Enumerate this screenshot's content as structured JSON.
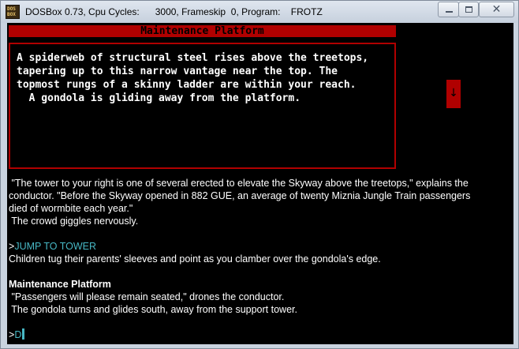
{
  "window": {
    "icon_line1": "DOS",
    "icon_line2": "BOX",
    "title": "DOSBox 0.73, Cpu Cycles:      3000, Frameskip  0, Program:    FROTZ"
  },
  "status": {
    "location": "Maintenance Platform"
  },
  "description": [
    "A spiderweb of structural steel rises above the treetops,",
    "tapering up to this narrow vantage near the top. The",
    "topmost rungs of a skinny ladder are within your reach.",
    "  A gondola is gliding away from the platform."
  ],
  "transcript": {
    "paragraph_lines": [
      " \"The tower to your right is one of several erected to elevate the Skyway above the treetops,\" explains the",
      "conductor. \"Before the Skyway opened in 882 GUE, an average of twenty Miznia Jungle Train passengers",
      "died of wormbite each year.\"",
      " The crowd giggles nervously."
    ],
    "prompt_symbol": ">",
    "command": "JUMP TO TOWER",
    "response": "Children tug their parents' sleeves and point as you clamber over the gondola's edge.",
    "room_name": "Maintenance Platform",
    "room_lines": [
      " \"Passengers will please remain seated,\" drones the conductor.",
      " The gondola turns and glides south, away from the support tower."
    ],
    "input_prompt": ">",
    "input_value": "D"
  },
  "icons": {
    "scroll": "arrow-down-icon"
  },
  "colors": {
    "status_bar": "#b00000",
    "background": "#000000",
    "command_text": "#47b7c4",
    "text": "#ffffff"
  }
}
